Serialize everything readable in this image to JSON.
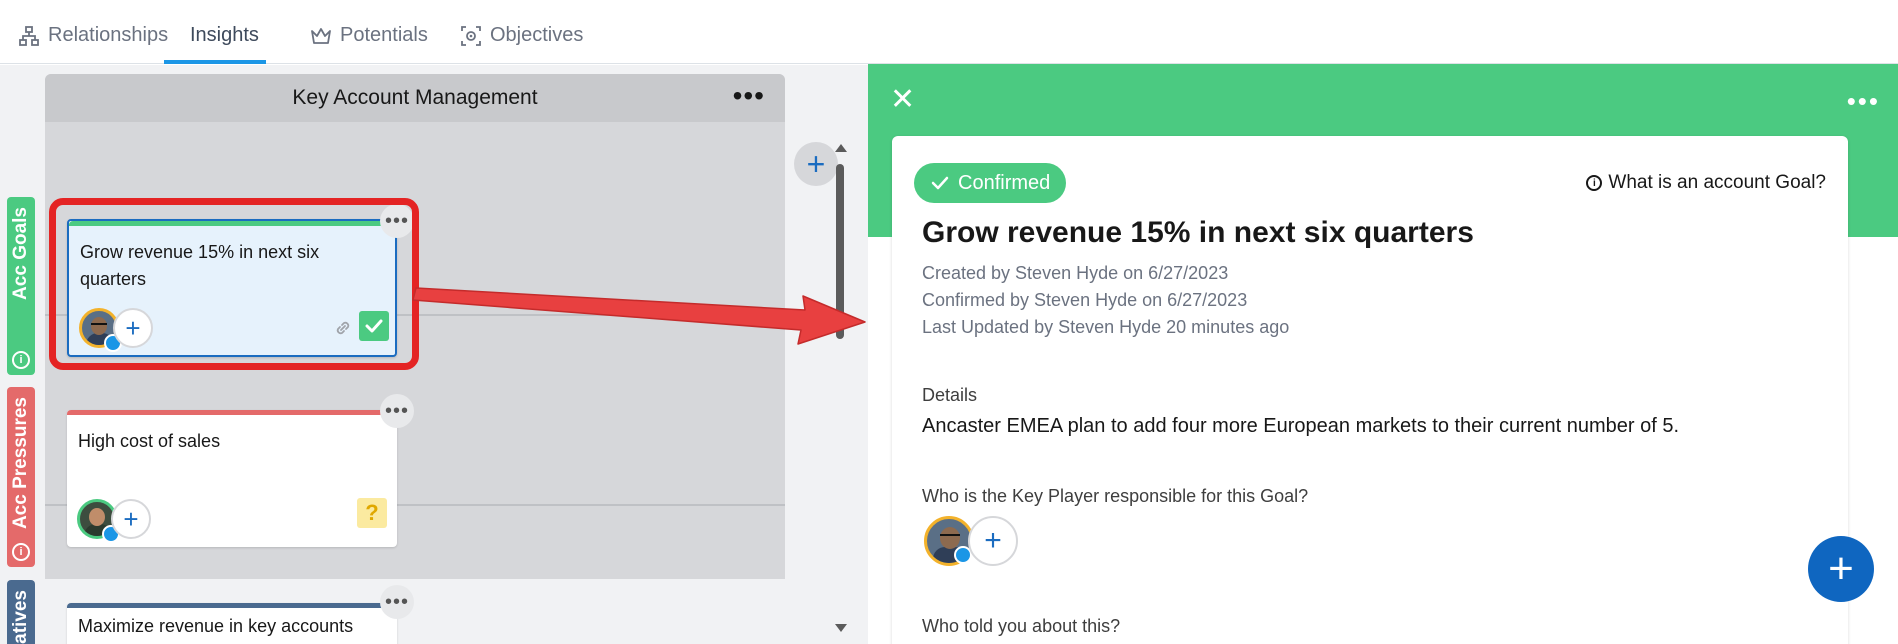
{
  "tabs": [
    {
      "label": "Relationships",
      "icon": "hierarchy-icon",
      "active": false
    },
    {
      "label": "Insights",
      "icon": "insights-icon",
      "active": true
    },
    {
      "label": "Potentials",
      "icon": "crown-icon",
      "active": false
    },
    {
      "label": "Objectives",
      "icon": "target-icon",
      "active": false
    }
  ],
  "board": {
    "column_title": "Key Account Management",
    "lanes": {
      "goals": {
        "label": "Acc Goals",
        "color": "#4bca81"
      },
      "pressures": {
        "label": "Acc Pressures",
        "color": "#e46a6a"
      },
      "initiatives": {
        "label": "atives",
        "color": "#4a6a8f"
      }
    },
    "cards": [
      {
        "title": "Grow revenue 15% in next six quarters",
        "status": "confirmed"
      },
      {
        "title": "High cost of sales",
        "status_glyph": "?"
      },
      {
        "title": "Maximize revenue in key accounts"
      }
    ]
  },
  "panel": {
    "status_label": "Confirmed",
    "help_link": "What is an account Goal?",
    "title": "Grow revenue 15% in next six quarters",
    "created": "Created by Steven Hyde on 6/27/2023",
    "confirmed": "Confirmed by Steven Hyde on 6/27/2023",
    "updated": "Last Updated by Steven Hyde 20 minutes ago",
    "details_label": "Details",
    "details_text": "Ancaster EMEA plan to add four more European markets to their current number of 5.",
    "key_player_label": "Who is the Key Player responsible for this Goal?",
    "told_label": "Who told you about this?"
  },
  "colors": {
    "accent_green": "#4bca81",
    "brand_blue": "#1b96e6",
    "highlight_red": "#e42424"
  }
}
